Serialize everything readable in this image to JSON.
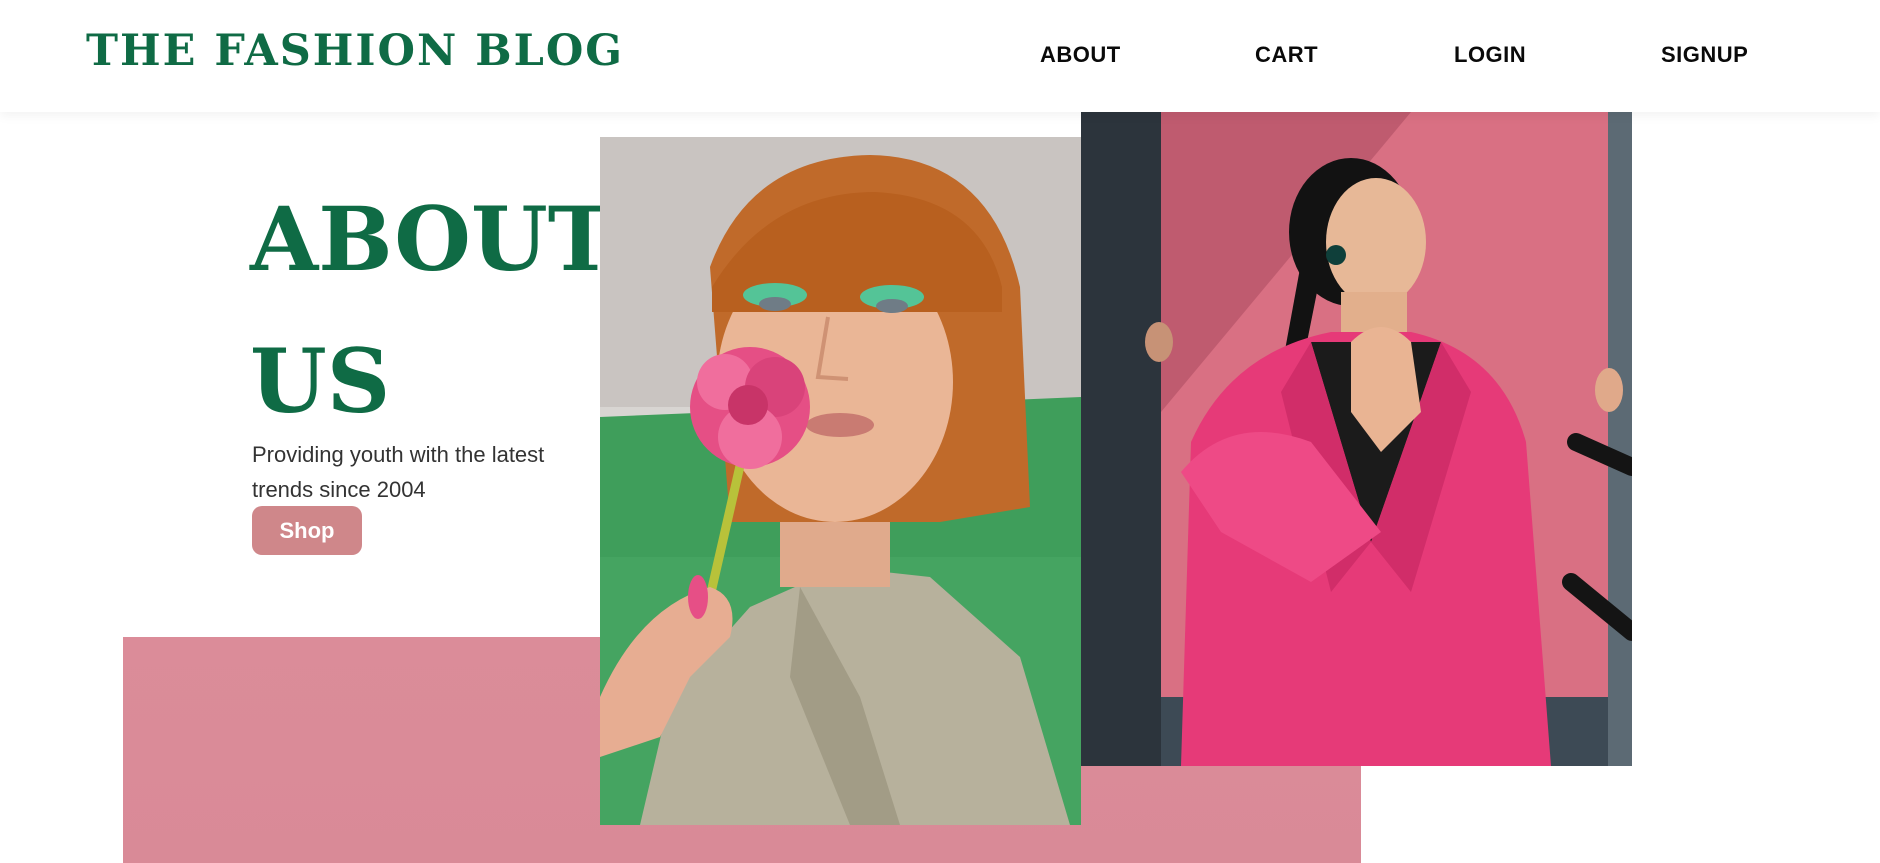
{
  "brand": {
    "name": "THE FASHION BLOG",
    "color": "#0f6b45"
  },
  "nav": {
    "about": "ABOUT",
    "cart": "CART",
    "login": "LOGIN",
    "signup": "SIGNUP"
  },
  "hero": {
    "title": "ABOUT US",
    "subtitle": "Providing youth with the latest trends since 2004",
    "cta_label": "Shop"
  },
  "colors": {
    "accent_pink": "#db8c99",
    "button": "#cf878a",
    "text": "#333333"
  }
}
